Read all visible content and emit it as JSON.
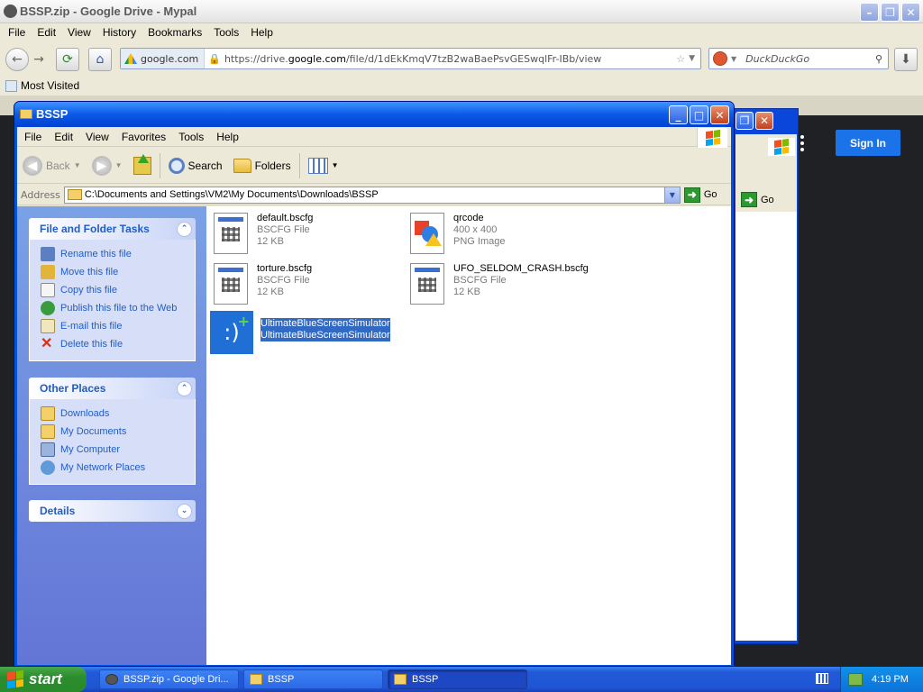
{
  "browser": {
    "title": "BSSP.zip - Google Drive - Mypal",
    "menu": [
      "File",
      "Edit",
      "View",
      "History",
      "Bookmarks",
      "Tools",
      "Help"
    ],
    "url_site": "google.com",
    "url_prefix": "https://drive.",
    "url_domain": "google.com",
    "url_rest": "/file/d/1dEkKmqV7tzB2waBaePsvGESwqlFr-IBb/view",
    "search_placeholder": "DuckDuckGo",
    "bookmarks_label": "Most Visited",
    "signin_label": "Sign In"
  },
  "explorer": {
    "title": "BSSP",
    "menu": [
      "File",
      "Edit",
      "View",
      "Favorites",
      "Tools",
      "Help"
    ],
    "toolbar": {
      "back": "Back",
      "search": "Search",
      "folders": "Folders"
    },
    "address_label": "Address",
    "address_path": "C:\\Documents and Settings\\VM2\\My Documents\\Downloads\\BSSP",
    "go_label": "Go",
    "file_tasks": {
      "title": "File and Folder Tasks",
      "items": [
        "Rename this file",
        "Move this file",
        "Copy this file",
        "Publish this file to the Web",
        "E-mail this file",
        "Delete this file"
      ]
    },
    "other_places": {
      "title": "Other Places",
      "items": [
        "Downloads",
        "My Documents",
        "My Computer",
        "My Network Places"
      ]
    },
    "details": {
      "title": "Details"
    },
    "files": [
      {
        "name": "default.bscfg",
        "type": "BSCFG File",
        "size": "12 KB"
      },
      {
        "name": "qrcode",
        "type": "400 x 400",
        "size": "PNG Image"
      },
      {
        "name": "torture.bscfg",
        "type": "BSCFG File",
        "size": "12 KB"
      },
      {
        "name": "UFO_SELDOM_CRASH.bscfg",
        "type": "BSCFG File",
        "size": "12 KB"
      },
      {
        "name": "UltimateBlueScreenSimulator",
        "type": "UltimateBlueScreenSimulator",
        "size": ""
      }
    ]
  },
  "explorer2": {
    "go_label": "Go"
  },
  "taskbar": {
    "start_label": "start",
    "items": [
      "BSSP.zip - Google Dri...",
      "BSSP",
      "BSSP"
    ],
    "clock": "4:19 PM"
  }
}
